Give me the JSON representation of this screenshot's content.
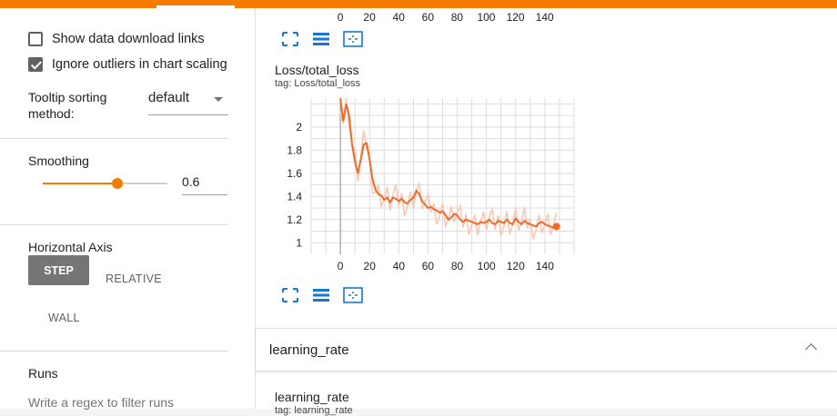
{
  "colors": {
    "accent": "#f57c00",
    "series": "#f06a2a",
    "series_raw": "#f8c8b4",
    "grid": "#dddddd"
  },
  "settings": {
    "show_download_label": "Show data download links",
    "show_download_checked": false,
    "ignore_outliers_label": "Ignore outliers in chart scaling",
    "ignore_outliers_checked": true,
    "tooltip_label_line1": "Tooltip sorting",
    "tooltip_label_line2": "method:",
    "tooltip_value": "default",
    "smoothing_label": "Smoothing",
    "smoothing_value": "0.6",
    "smoothing_fraction": 0.6,
    "horizontal_axis_label": "Horizontal Axis",
    "axis_options": [
      "STEP",
      "RELATIVE",
      "WALL"
    ],
    "axis_selected": "STEP",
    "runs_label": "Runs",
    "runs_filter_placeholder": "Write a regex to filter runs"
  },
  "top_chart": {
    "x_ticks": [
      "0",
      "20",
      "40",
      "60",
      "80",
      "100",
      "120",
      "140"
    ],
    "icons": [
      "fullscreen-icon",
      "data-table-icon",
      "fit-domain-icon"
    ]
  },
  "loss_card": {
    "title": "Loss/total_loss",
    "tag": "tag: Loss/total_loss",
    "icons": [
      "fullscreen-icon",
      "data-table-icon",
      "fit-domain-icon"
    ]
  },
  "chart_data": {
    "type": "line",
    "title": "Loss/total_loss",
    "xlabel": "",
    "ylabel": "",
    "x_ticks": [
      0,
      20,
      40,
      60,
      80,
      100,
      120,
      140
    ],
    "y_ticks": [
      1,
      1.2,
      1.4,
      1.6,
      1.8,
      2
    ],
    "xlim": [
      -20,
      160
    ],
    "ylim": [
      0.9,
      2.25
    ],
    "grid": true,
    "series": [
      {
        "x": [
          0,
          2,
          4,
          6,
          8,
          10,
          12,
          14,
          16,
          18,
          20,
          22,
          24,
          26,
          28,
          30,
          32,
          34,
          36,
          38,
          40,
          42,
          44,
          46,
          48,
          50,
          52,
          54,
          56,
          58,
          60,
          62,
          64,
          66,
          68,
          70,
          72,
          74,
          76,
          78,
          80,
          82,
          84,
          86,
          88,
          90,
          92,
          94,
          96,
          98,
          100,
          102,
          104,
          106,
          108,
          110,
          112,
          114,
          116,
          118,
          120,
          122,
          124,
          126,
          128,
          130,
          132,
          134,
          136,
          138,
          140,
          142,
          144,
          146,
          148
        ],
        "y": [
          2.25,
          2.05,
          2.2,
          2.1,
          1.85,
          1.7,
          1.6,
          1.72,
          1.85,
          1.86,
          1.72,
          1.55,
          1.46,
          1.42,
          1.41,
          1.37,
          1.39,
          1.35,
          1.39,
          1.38,
          1.36,
          1.38,
          1.35,
          1.34,
          1.37,
          1.39,
          1.45,
          1.42,
          1.36,
          1.33,
          1.3,
          1.31,
          1.29,
          1.28,
          1.26,
          1.27,
          1.24,
          1.2,
          1.22,
          1.25,
          1.24,
          1.2,
          1.18,
          1.2,
          1.19,
          1.18,
          1.17,
          1.16,
          1.18,
          1.17,
          1.18,
          1.2,
          1.17,
          1.16,
          1.19,
          1.18,
          1.17,
          1.2,
          1.17,
          1.16,
          1.21,
          1.18,
          1.16,
          1.19,
          1.17,
          1.16,
          1.15,
          1.14,
          1.17,
          1.18,
          1.16,
          1.15,
          1.14,
          1.13,
          1.14
        ]
      }
    ]
  },
  "lr_section": {
    "title": "learning_rate"
  },
  "lr_card": {
    "title": "learning_rate",
    "tag": "tag: learning_rate"
  }
}
